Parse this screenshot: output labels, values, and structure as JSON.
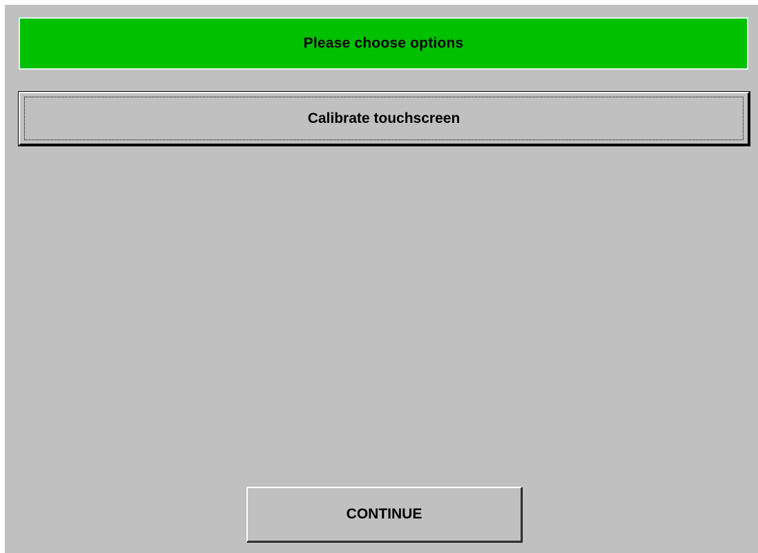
{
  "header": {
    "title": "Please choose options",
    "color": "#00c000"
  },
  "options": [
    {
      "label": "Calibrate touchscreen"
    }
  ],
  "footer": {
    "continue_label": "CONTINUE"
  },
  "background_color": "#c0c0c0"
}
